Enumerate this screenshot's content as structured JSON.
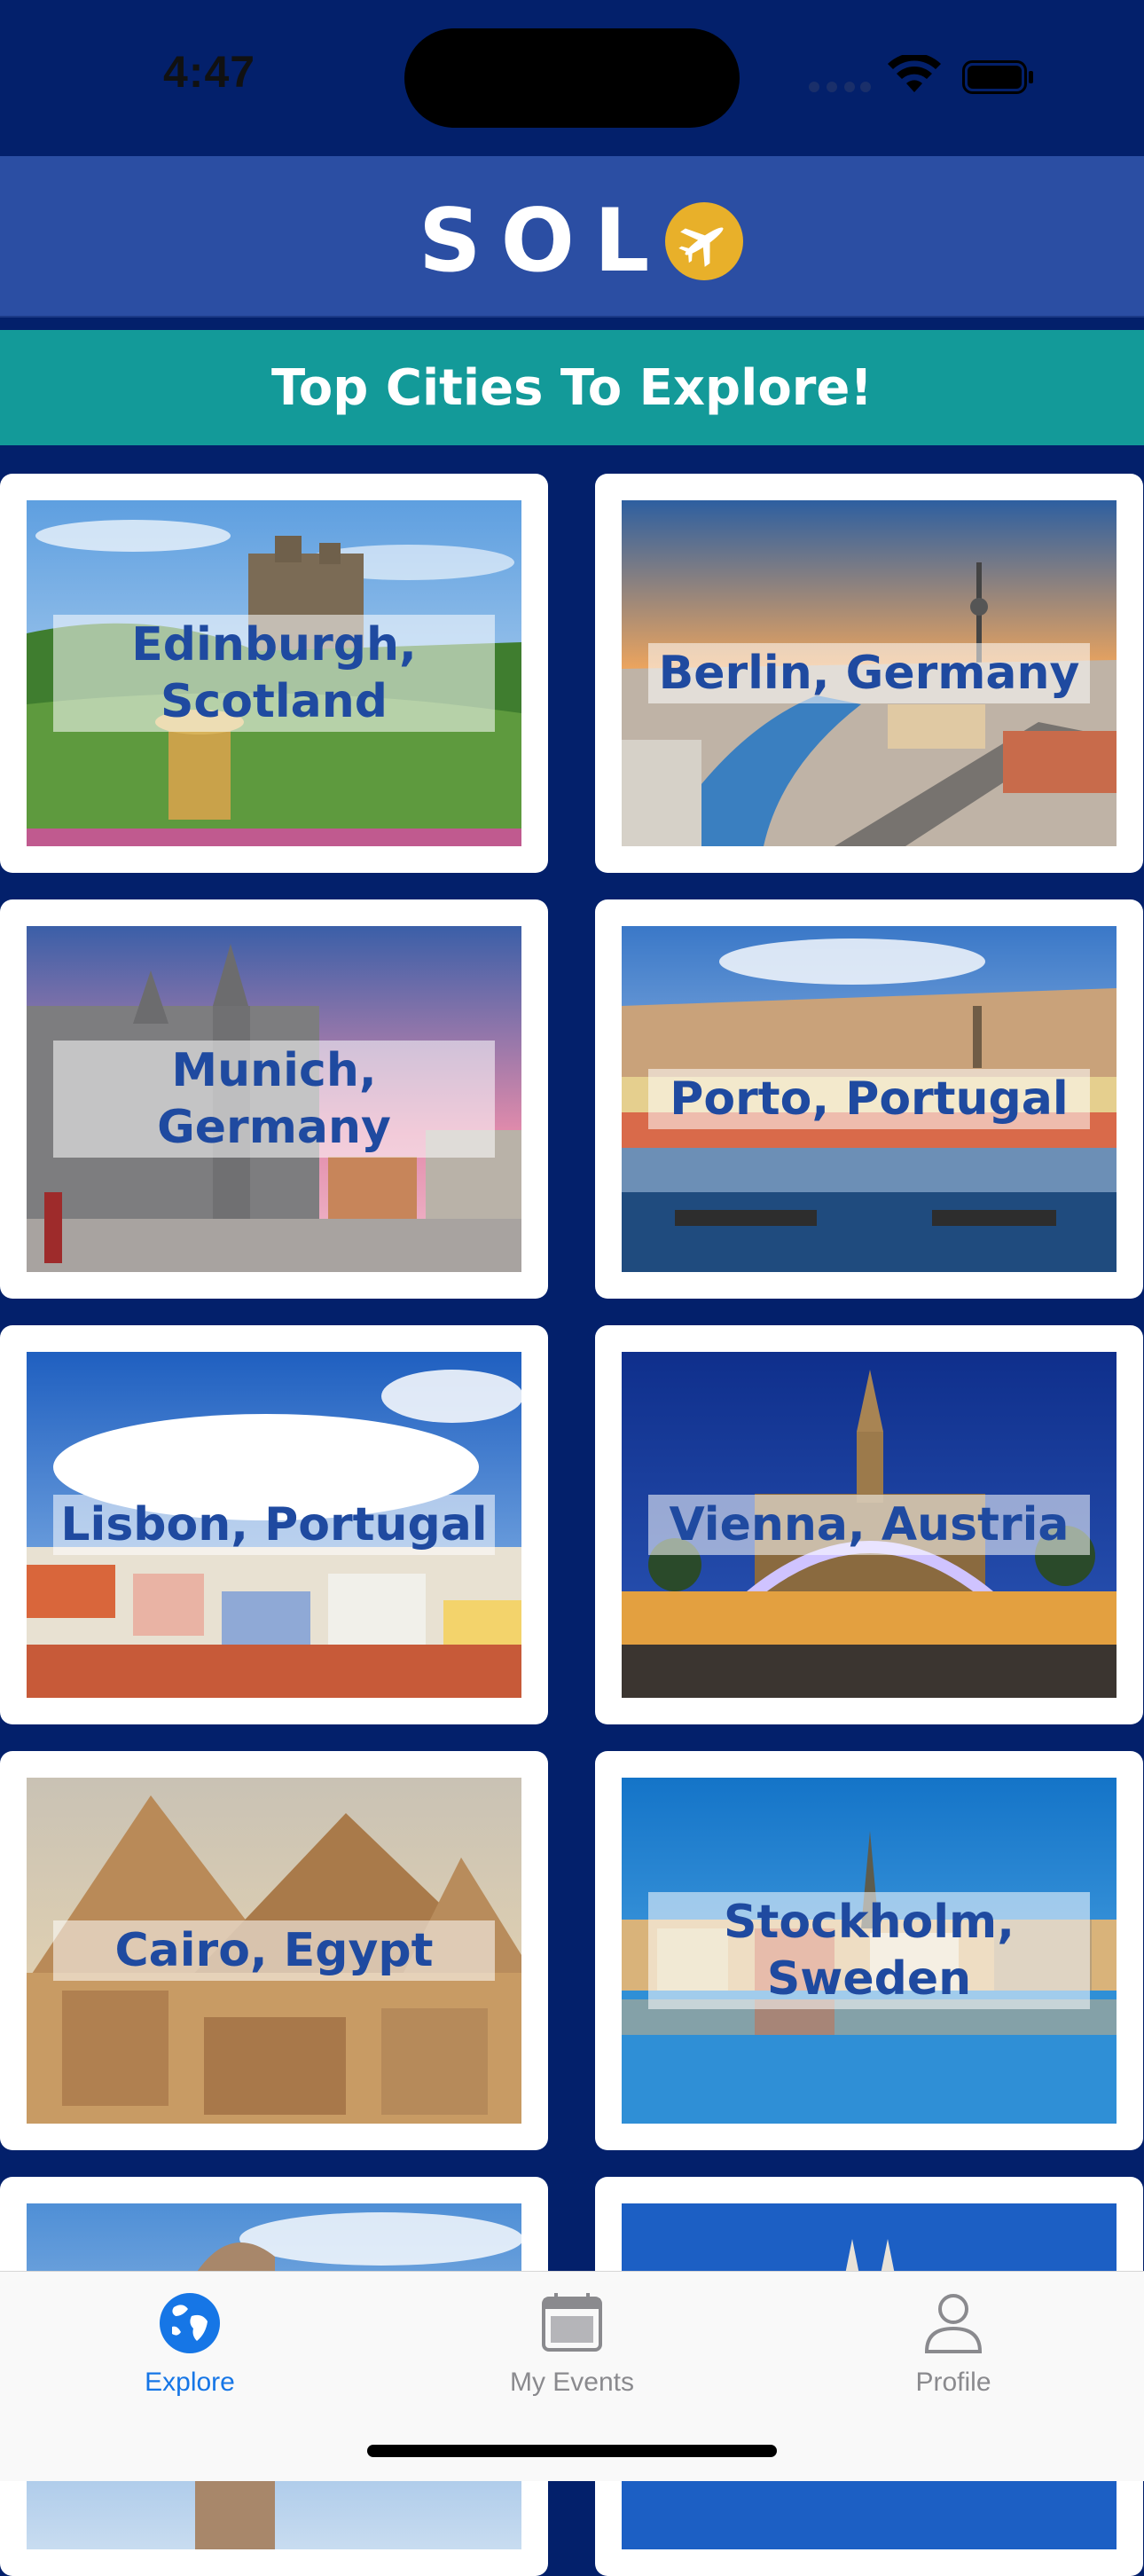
{
  "status_bar": {
    "time": "4:47"
  },
  "header": {
    "logo_text": "SOL"
  },
  "banner": {
    "title": "Top Cities To Explore!"
  },
  "cities": [
    {
      "label": "Edinburgh, Scotland"
    },
    {
      "label": "Berlin, Germany"
    },
    {
      "label": "Munich, Germany"
    },
    {
      "label": "Porto, Portugal"
    },
    {
      "label": "Lisbon, Portugal"
    },
    {
      "label": "Vienna, Austria"
    },
    {
      "label": "Cairo, Egypt"
    },
    {
      "label": "Stockholm, Sweden"
    }
  ],
  "tab_bar": {
    "explore": "Explore",
    "my_events": "My Events",
    "profile": "Profile"
  },
  "colors": {
    "background": "#03206b",
    "header": "#2b4ea3",
    "banner": "#139a99",
    "label_text": "#1f4aa0",
    "active_tab": "#1676e6",
    "logo_plane": "#e8b02a"
  },
  "icons": [
    "wifi-icon",
    "battery-icon",
    "plane-icon",
    "globe-icon",
    "calendar-icon",
    "person-icon"
  ]
}
